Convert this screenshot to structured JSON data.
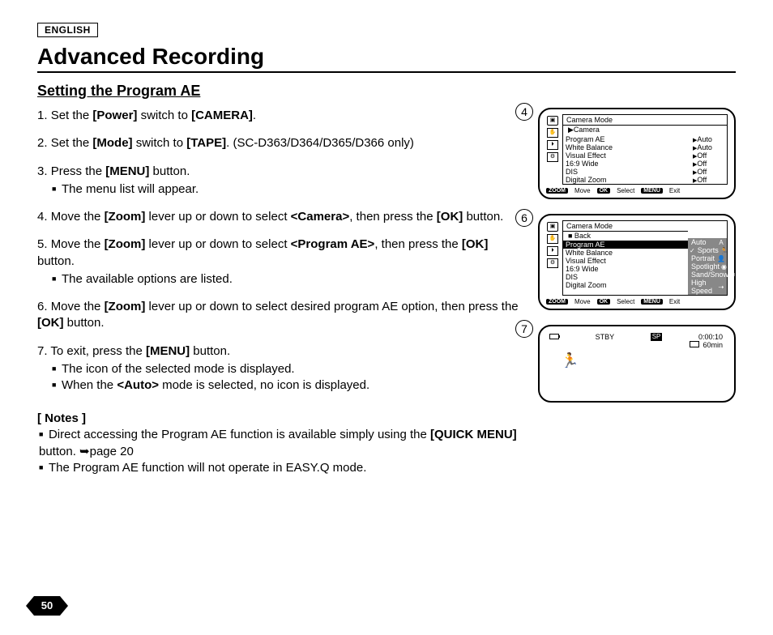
{
  "lang_label": "ENGLISH",
  "title": "Advanced Recording",
  "section": "Setting the Program AE",
  "steps": [
    {
      "num": "1.",
      "parts": [
        "Set the ",
        "[Power]",
        " switch to ",
        "[CAMERA]",
        "."
      ]
    },
    {
      "num": "2.",
      "parts": [
        "Set the ",
        "[Mode]",
        " switch to ",
        "[TAPE]",
        ". (SC-D363/D364/D365/D366 only)"
      ]
    },
    {
      "num": "3.",
      "parts": [
        "Press the ",
        "[MENU]",
        " button."
      ],
      "sub": [
        "The menu list will appear."
      ]
    },
    {
      "num": "4.",
      "parts": [
        "Move the ",
        "[Zoom]",
        " lever up or down to select ",
        "<Camera>",
        ", then press the ",
        "[OK]",
        " button."
      ]
    },
    {
      "num": "5.",
      "parts": [
        "Move the ",
        "[Zoom]",
        " lever up or down to select ",
        "<Program AE>",
        ", then press the ",
        "[OK]",
        " button."
      ],
      "sub": [
        "The available options are listed."
      ]
    },
    {
      "num": "6.",
      "parts": [
        "Move the ",
        "[Zoom]",
        " lever up or down to select desired program AE option,  then press the ",
        "[OK]",
        " button."
      ]
    },
    {
      "num": "7.",
      "parts": [
        "To exit, press the ",
        "[MENU]",
        " button."
      ],
      "sub": [
        "The icon of the selected mode is displayed.",
        [
          "When the ",
          "<Auto>",
          " mode is selected, no icon is displayed."
        ]
      ]
    }
  ],
  "notes_head": "[ Notes ]",
  "notes": [
    [
      "Direct accessing the Program AE function is available simply using the ",
      "[QUICK MENU]",
      " button. ➥page 20"
    ],
    [
      "The Program AE function will not operate in EASY.Q mode."
    ]
  ],
  "panel4": {
    "circ": "4",
    "head": "Camera Mode",
    "subhead": "▶Camera",
    "rows": [
      {
        "lbl": "Program AE",
        "val": "Auto"
      },
      {
        "lbl": "White Balance",
        "val": "Auto"
      },
      {
        "lbl": "Visual Effect",
        "val": "Off"
      },
      {
        "lbl": "16:9 Wide",
        "val": "Off"
      },
      {
        "lbl": "DIS",
        "val": "Off"
      },
      {
        "lbl": "Digital Zoom",
        "val": "Off"
      }
    ],
    "hints": {
      "zoom": "ZOOM",
      "move": "Move",
      "ok": "OK",
      "select": "Select",
      "menu": "MENU",
      "exit": "Exit"
    }
  },
  "panel6": {
    "circ": "6",
    "head": "Camera Mode",
    "subhead": "■ Back",
    "rows": [
      {
        "lbl": "Program AE",
        "hi": true
      },
      {
        "lbl": "White Balance"
      },
      {
        "lbl": "Visual Effect"
      },
      {
        "lbl": "16:9 Wide"
      },
      {
        "lbl": "DIS"
      },
      {
        "lbl": "Digital Zoom"
      }
    ],
    "opts": [
      {
        "lbl": "Auto",
        "icon": "A"
      },
      {
        "lbl": "Sports",
        "hi": true,
        "check": true,
        "icon": "🏃"
      },
      {
        "lbl": "Portrait",
        "icon": "👤"
      },
      {
        "lbl": "Spotlight",
        "icon": "◉"
      },
      {
        "lbl": "Sand/Snow",
        "icon": "❄"
      },
      {
        "lbl": "High Speed",
        "icon": "⇢"
      }
    ],
    "hints": {
      "zoom": "ZOOM",
      "move": "Move",
      "ok": "OK",
      "select": "Select",
      "menu": "MENU",
      "exit": "Exit"
    }
  },
  "panel7": {
    "circ": "7",
    "stby": "STBY",
    "sp": "SP",
    "time": "0:00:10",
    "remain": "60min"
  },
  "page_number": "50"
}
